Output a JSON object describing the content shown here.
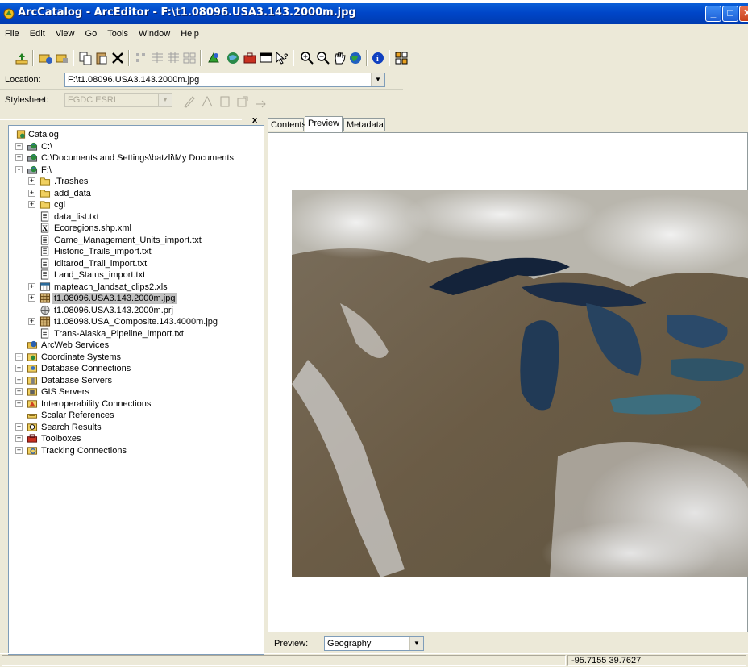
{
  "window": {
    "title": "ArcCatalog - ArcEditor - F:\\t1.08096.USA3.143.2000m.jpg",
    "minimize_glyph": "_",
    "maximize_glyph": "□",
    "close_glyph": "✕"
  },
  "menu": [
    "File",
    "Edit",
    "View",
    "Go",
    "Tools",
    "Window",
    "Help"
  ],
  "toolbar": {
    "icons": [
      "up-one-level-icon",
      "connect-folder-icon",
      "disconnect-folder-icon",
      "copy-icon",
      "paste-icon",
      "delete-icon",
      "large-icons-icon",
      "list-icon",
      "details-icon",
      "thumbnails-icon",
      "launch-arcmap-icon",
      "metadata-icon",
      "arctoolbox-icon",
      "command-line-icon",
      "whats-this-icon",
      "zoom-in-icon",
      "zoom-out-icon",
      "pan-icon",
      "full-extent-icon",
      "identify-icon",
      "create-thumbnail-icon"
    ]
  },
  "location": {
    "label": "Location:",
    "value": "F:\\t1.08096.USA3.143.2000m.jpg"
  },
  "stylesheet": {
    "label": "Stylesheet:",
    "value": "FGDC ESRI"
  },
  "tree": {
    "close_glyph": "x",
    "items": [
      {
        "label": "Catalog",
        "icon": "catalog-icon",
        "level": 0,
        "expander": ""
      },
      {
        "label": "C:\\",
        "icon": "drive-icon",
        "level": 1,
        "expander": "+"
      },
      {
        "label": "C:\\Documents and Settings\\batzli\\My Documents",
        "icon": "drive-icon",
        "level": 1,
        "expander": "+"
      },
      {
        "label": "F:\\",
        "icon": "drive-icon",
        "level": 1,
        "expander": "-"
      },
      {
        "label": ".Trashes",
        "icon": "folder-icon",
        "level": 2,
        "expander": "+"
      },
      {
        "label": "add_data",
        "icon": "folder-icon",
        "level": 2,
        "expander": "+"
      },
      {
        "label": "cgi",
        "icon": "folder-icon",
        "level": 2,
        "expander": "+"
      },
      {
        "label": "data_list.txt",
        "icon": "text-file-icon",
        "level": 2,
        "expander": ""
      },
      {
        "label": "Ecoregions.shp.xml",
        "icon": "xml-file-icon",
        "level": 2,
        "expander": ""
      },
      {
        "label": "Game_Management_Units_import.txt",
        "icon": "text-file-icon",
        "level": 2,
        "expander": ""
      },
      {
        "label": "Historic_Trails_import.txt",
        "icon": "text-file-icon",
        "level": 2,
        "expander": ""
      },
      {
        "label": "Iditarod_Trail_import.txt",
        "icon": "text-file-icon",
        "level": 2,
        "expander": ""
      },
      {
        "label": "Land_Status_import.txt",
        "icon": "text-file-icon",
        "level": 2,
        "expander": ""
      },
      {
        "label": "mapteach_landsat_clips2.xls",
        "icon": "spreadsheet-icon",
        "level": 2,
        "expander": "+"
      },
      {
        "label": "t1.08096.USA3.143.2000m.jpg",
        "icon": "raster-icon",
        "level": 2,
        "expander": "+",
        "selected": true
      },
      {
        "label": "t1.08096.USA3.143.2000m.prj",
        "icon": "projection-icon",
        "level": 2,
        "expander": ""
      },
      {
        "label": "t1.08098.USA_Composite.143.4000m.jpg",
        "icon": "raster-icon",
        "level": 2,
        "expander": "+"
      },
      {
        "label": "Trans-Alaska_Pipeline_import.txt",
        "icon": "text-file-icon",
        "level": 2,
        "expander": ""
      },
      {
        "label": "ArcWeb Services",
        "icon": "arcweb-icon",
        "level": 1,
        "expander": ""
      },
      {
        "label": "Coordinate Systems",
        "icon": "coordinate-systems-icon",
        "level": 1,
        "expander": "+"
      },
      {
        "label": "Database Connections",
        "icon": "database-connections-icon",
        "level": 1,
        "expander": "+"
      },
      {
        "label": "Database Servers",
        "icon": "database-servers-icon",
        "level": 1,
        "expander": "+"
      },
      {
        "label": "GIS Servers",
        "icon": "gis-servers-icon",
        "level": 1,
        "expander": "+"
      },
      {
        "label": "Interoperability Connections",
        "icon": "interoperability-icon",
        "level": 1,
        "expander": "+"
      },
      {
        "label": "Scalar References",
        "icon": "scalar-references-icon",
        "level": 1,
        "expander": ""
      },
      {
        "label": "Search Results",
        "icon": "search-results-icon",
        "level": 1,
        "expander": "+"
      },
      {
        "label": "Toolboxes",
        "icon": "toolboxes-icon",
        "level": 1,
        "expander": "+"
      },
      {
        "label": "Tracking Connections",
        "icon": "tracking-connections-icon",
        "level": 1,
        "expander": "+"
      }
    ]
  },
  "tabs": [
    {
      "label": "Contents",
      "active": false
    },
    {
      "label": "Preview",
      "active": true
    },
    {
      "label": "Metadata",
      "active": false
    }
  ],
  "preview": {
    "label": "Preview:",
    "mode": "Geography"
  },
  "status": {
    "coordinates": "-95.7155  39.7627"
  },
  "colors": {
    "titlebar": "#0046c8",
    "chrome": "#ece9d8",
    "selection": "#c0c0c0"
  }
}
